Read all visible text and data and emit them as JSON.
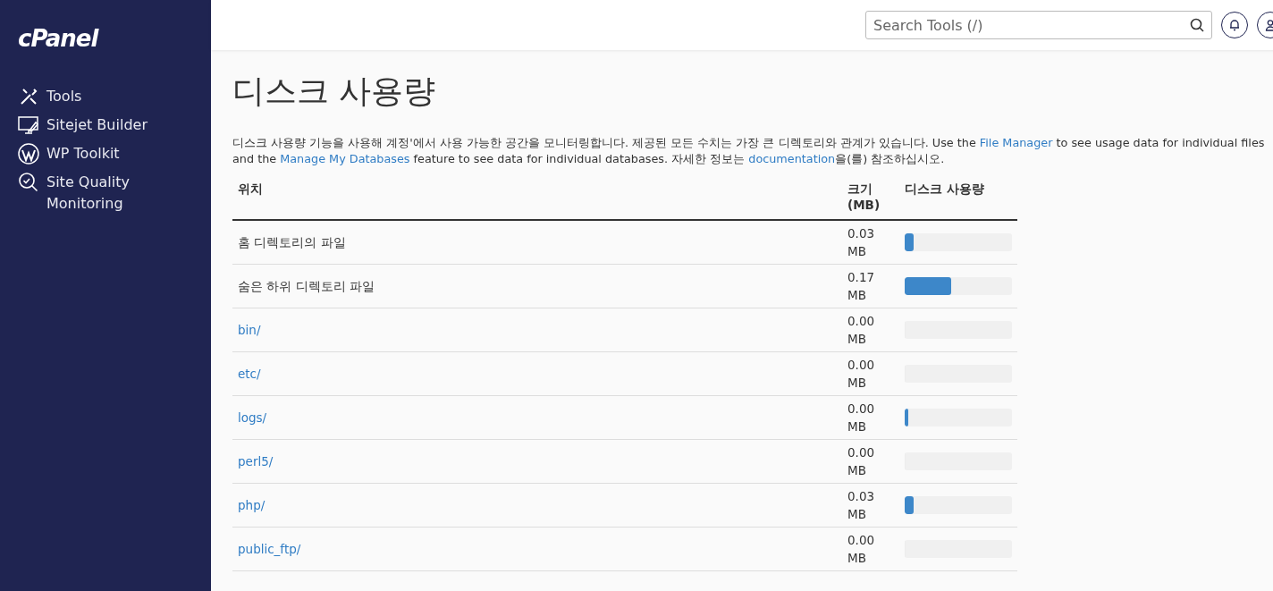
{
  "sidebar": {
    "logo": "cPanel",
    "items": [
      {
        "label": "Tools"
      },
      {
        "label": "Sitejet Builder"
      },
      {
        "label": "WP Toolkit"
      },
      {
        "label": "Site Quality Monitoring"
      }
    ]
  },
  "header": {
    "search": {
      "placeholder": "Search Tools (/)"
    }
  },
  "page": {
    "title": "디스크 사용량",
    "description": [
      {
        "text": "디스크 사용량 기능을 사용해 계정'에서 사용 가능한 공간을 모니터링합니다. 제공된 모든 수치는 가장 큰 디렉토리와 관계가 있습니다. Use the ",
        "link": false
      },
      {
        "text": "File Manager",
        "link": true
      },
      {
        "text": " to see usage data for individual files and the ",
        "link": false
      },
      {
        "text": "Manage My Databases",
        "link": true
      },
      {
        "text": " feature to see data for individual databases. 자세한 정보는 ",
        "link": false
      },
      {
        "text": "documentation",
        "link": true
      },
      {
        "text": "을(를) 참조하십시오.",
        "link": false
      }
    ]
  },
  "table": {
    "columns": [
      "위치",
      "크기 (MB)",
      "디스크 사용량"
    ],
    "rows": [
      {
        "location": "홈 디렉토리의 파일",
        "link": false,
        "size": "0.03 MB",
        "level": 0.08
      },
      {
        "location": "숨은 하위 디렉토리 파일",
        "link": false,
        "size": "0.17 MB",
        "level": 0.43
      },
      {
        "location": "bin/",
        "link": true,
        "size": "0.00 MB",
        "level": 0
      },
      {
        "location": "etc/",
        "link": true,
        "size": "0.00 MB",
        "level": 0
      },
      {
        "location": "logs/",
        "link": true,
        "size": "0.00 MB",
        "level": 0.03
      },
      {
        "location": "perl5/",
        "link": true,
        "size": "0.00 MB",
        "level": 0
      },
      {
        "location": "php/",
        "link": true,
        "size": "0.03 MB",
        "level": 0.08
      },
      {
        "location": "public_ftp/",
        "link": true,
        "size": "0.00 MB",
        "level": 0
      }
    ]
  }
}
